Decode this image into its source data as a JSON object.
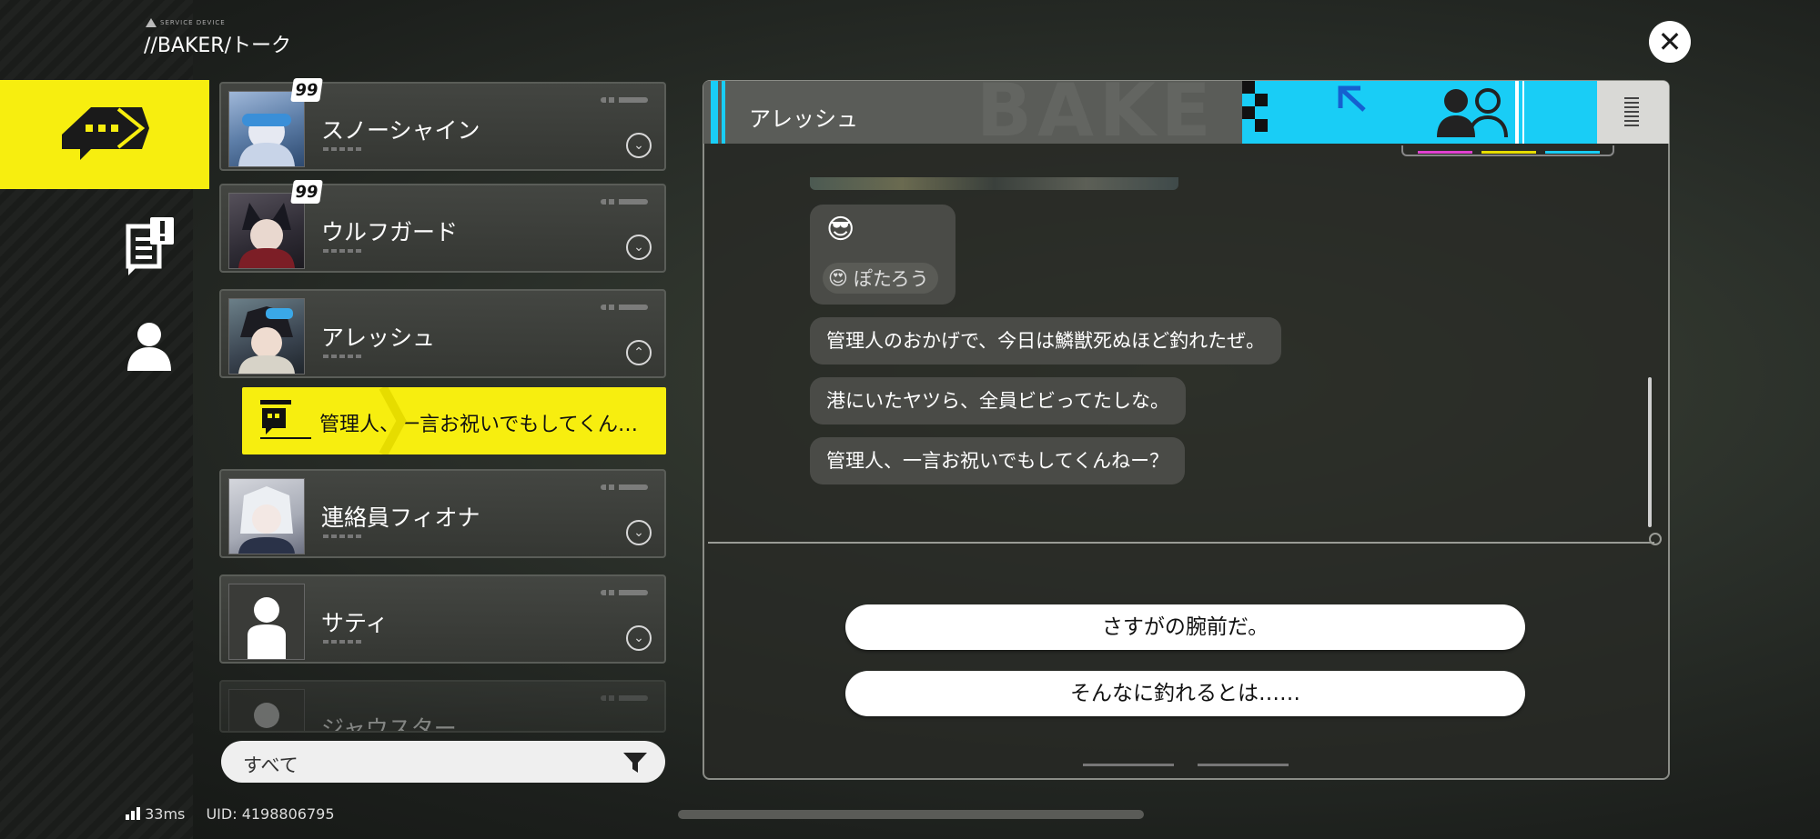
{
  "header": {
    "logo_text": "SERVICE DEVICE",
    "breadcrumb": "//BAKER/トーク",
    "close_label": "✕"
  },
  "contacts": [
    {
      "name": "スノーシャイン",
      "badge": "99",
      "chevron": "⌄"
    },
    {
      "name": "ウルフガード",
      "badge": "99",
      "chevron": "⌄"
    },
    {
      "name": "アレッシュ",
      "badge": "",
      "chevron": "⌃"
    },
    {
      "name": "連絡員フィオナ",
      "badge": "",
      "chevron": "⌄"
    },
    {
      "name": "サティ",
      "badge": "",
      "chevron": "⌄"
    },
    {
      "name": "ジャウスター",
      "badge": "",
      "chevron": ""
    }
  ],
  "active_thread": {
    "preview": "管理人、一言お祝いでもしてくん…"
  },
  "filter": {
    "label": "すべて"
  },
  "status": {
    "ping": "33ms",
    "uid": "UID: 4198806795"
  },
  "chat": {
    "title": "アレッシュ",
    "header_bg_text": "BAKE",
    "emoji": "😎",
    "reaction_emoji": "😍",
    "reaction_name": "ぽたろう",
    "messages": [
      "管理人のおかげで、今日は鱗獣死ぬほど釣れたぜ。",
      "港にいたヤツら、全員ビビってたしな。",
      "管理人、一言お祝いでもしてくんねー？"
    ],
    "choices": [
      "さすがの腕前だ。",
      "そんなに釣れるとは……"
    ]
  },
  "colors": {
    "accent_yellow": "#f7ee0f",
    "accent_cyan": "#19cdf6"
  }
}
